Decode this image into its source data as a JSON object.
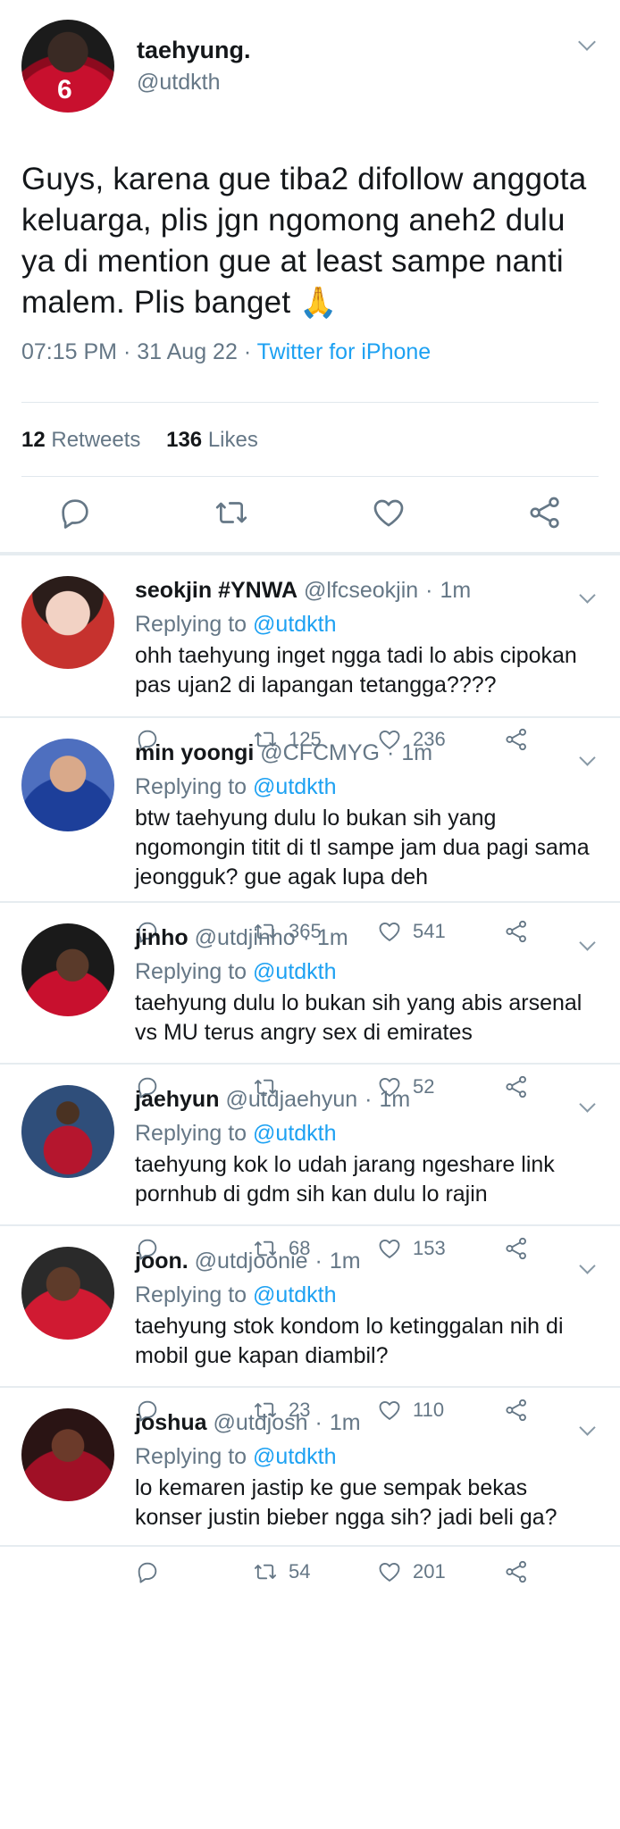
{
  "main_tweet": {
    "author_name": "taehyung.",
    "author_handle": "@utdkth",
    "avatar_text": "6",
    "text": "Guys, karena gue tiba2 difollow anggota keluarga, plis jgn ngomong aneh2 dulu ya di mention gue at least sampe nanti malem. Plis banget",
    "emoji": "🙏",
    "time": "07:15 PM",
    "date": "31 Aug 22",
    "dot": "·",
    "source": "Twitter for iPhone",
    "retweets_count": "12",
    "retweets_label": "Retweets",
    "likes_count": "136",
    "likes_label": "Likes"
  },
  "replies": [
    {
      "name": "seokjin #YNWA",
      "handle": "@lfcseokjin",
      "time": "1m",
      "replying_label": "Replying to",
      "replying_to": "@utdkth",
      "text": "ohh taehyung inget ngga tadi lo abis cipokan pas ujan2 di lapangan tetangga????",
      "retweets": "125",
      "likes": "236"
    },
    {
      "name": "min yoongi",
      "handle": "@CFCMYG",
      "time": "1m",
      "replying_label": "Replying to",
      "replying_to": "@utdkth",
      "text": "btw taehyung dulu lo bukan sih yang ngomongin titit di tl sampe jam dua pagi sama jeongguk? gue agak lupa deh",
      "retweets": "365",
      "likes": "541"
    },
    {
      "name": "jinho",
      "handle": "@utdjinho",
      "time": "1m",
      "replying_label": "Replying to",
      "replying_to": "@utdkth",
      "text": "taehyung dulu lo bukan sih yang abis arsenal vs MU terus angry sex di emirates",
      "retweets": "",
      "likes": "52"
    },
    {
      "name": "jaehyun",
      "handle": "@utdjaehyun",
      "time": "1m",
      "replying_label": "Replying to",
      "replying_to": "@utdkth",
      "text": "taehyung kok lo udah jarang ngeshare link pornhub di gdm sih kan dulu lo rajin",
      "retweets": "68",
      "likes": "153"
    },
    {
      "name": "joon.",
      "handle": "@utdjoonie",
      "time": "1m",
      "replying_label": "Replying to",
      "replying_to": "@utdkth",
      "text": "taehyung stok kondom lo ketinggalan nih di mobil gue kapan diambil?",
      "retweets": "23",
      "likes": "110"
    },
    {
      "name": "joshua",
      "handle": "@utdjosh",
      "time": "1m",
      "replying_label": "Replying to",
      "replying_to": "@utdkth",
      "text": "lo kemaren jastip ke gue sempak bekas konser justin bieber ngga sih? jadi beli ga?",
      "retweets": "54",
      "likes": "201"
    }
  ],
  "icons": {
    "reply": "reply-icon",
    "retweet": "retweet-icon",
    "like": "heart-icon",
    "share": "share-icon",
    "more": "chevron-down-icon"
  },
  "colors": {
    "link": "#1da1f2",
    "muted": "#657786",
    "divider": "#e6ecf0"
  }
}
